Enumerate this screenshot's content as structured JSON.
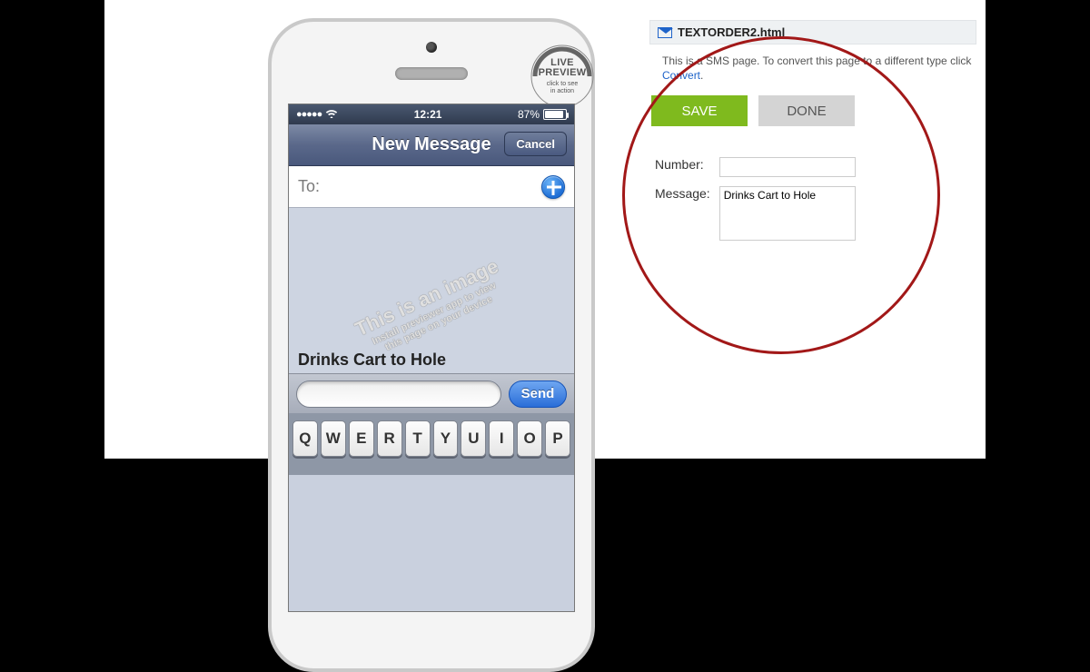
{
  "phone": {
    "status": {
      "time": "12:21",
      "battery_pct": "87%"
    },
    "nav": {
      "title": "New Message",
      "cancel": "Cancel"
    },
    "to_label": "To:",
    "message_text": "Drinks Cart to Hole",
    "send_label": "Send",
    "keys": [
      "Q",
      "W",
      "E",
      "R",
      "T",
      "Y",
      "U",
      "I",
      "O",
      "P"
    ]
  },
  "live_badge": {
    "line1": "LIVE",
    "line2": "PREVIEW",
    "sub": "click to see\nin action"
  },
  "watermark": {
    "line1": "This is an image",
    "line2": "Install previewer app to view",
    "line3": "this page on your device"
  },
  "panel": {
    "filename": "TEXTORDER2.html",
    "hint_prefix": "This is a SMS page. To convert this page to a different type click ",
    "hint_link": "Convert",
    "hint_suffix": ".",
    "save_label": "SAVE",
    "done_label": "DONE",
    "number_label": "Number:",
    "number_value": "",
    "message_label": "Message:",
    "message_value": "Drinks Cart to Hole"
  }
}
